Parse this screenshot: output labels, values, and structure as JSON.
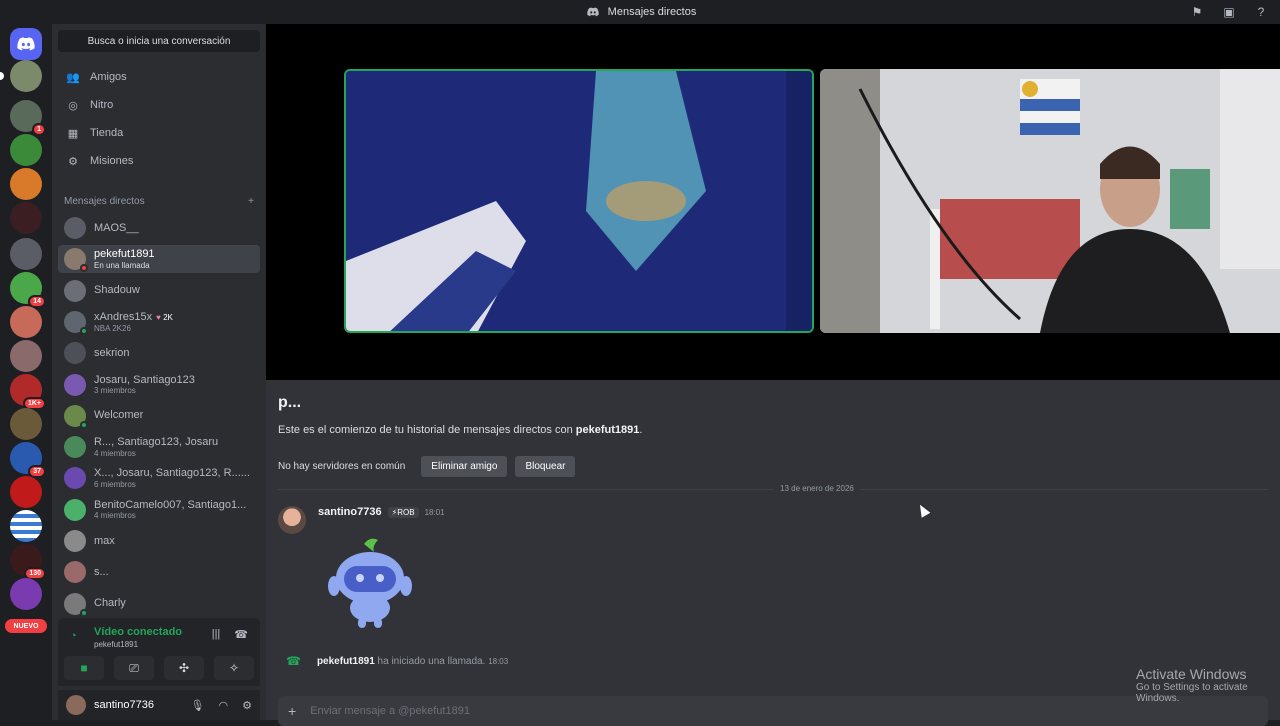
{
  "titlebar": {
    "title": "Mensajes directos"
  },
  "rail": {
    "servers": [
      {
        "id": "home",
        "badge": ""
      },
      {
        "id": "s1",
        "badge": ""
      },
      {
        "id": "s2",
        "badge": "1"
      },
      {
        "id": "s3",
        "badge": ""
      },
      {
        "id": "s4",
        "badge": ""
      },
      {
        "id": "s5",
        "badge": ""
      },
      {
        "id": "s6",
        "badge": ""
      },
      {
        "id": "s7",
        "badge": "14"
      },
      {
        "id": "s8",
        "badge": ""
      },
      {
        "id": "s9",
        "badge": ""
      },
      {
        "id": "s10",
        "badge": "1K+"
      },
      {
        "id": "s11",
        "badge": ""
      },
      {
        "id": "s12",
        "badge": "37"
      },
      {
        "id": "s13",
        "badge": ""
      },
      {
        "id": "s14",
        "badge": ""
      },
      {
        "id": "s15",
        "badge": "130"
      },
      {
        "id": "s16",
        "badge": ""
      }
    ],
    "nuevo_label": "NUEVO"
  },
  "sidebar": {
    "search_label": "Busca o inicia una conversación",
    "nav": [
      {
        "label": "Amigos",
        "icon": "friends-icon"
      },
      {
        "label": "Nitro",
        "icon": "nitro-icon"
      },
      {
        "label": "Tienda",
        "icon": "shop-icon"
      },
      {
        "label": "Misiones",
        "icon": "quests-icon"
      }
    ],
    "dm_header": "Mensajes directos",
    "dms": [
      {
        "name": "MAOS__",
        "sub": "",
        "color": "#5a5d66",
        "status": ""
      },
      {
        "name": "pekefut1891",
        "sub": "En una llamada",
        "color": "#8a7a6e",
        "status": "#f23f43"
      },
      {
        "name": "Shadouw",
        "sub": "",
        "color": "#6b6e77",
        "status": ""
      },
      {
        "name": "xAndres15x",
        "sub": "NBA 2K26",
        "color": "#5f6670",
        "status": "#23a55a",
        "badge": "2K"
      },
      {
        "name": "sekrion",
        "sub": "",
        "color": "#4d5058",
        "status": ""
      },
      {
        "name": "Josaru, Santiago123",
        "sub": "3 miembros",
        "color": "#7a5ab0",
        "status": ""
      },
      {
        "name": "Welcomer",
        "sub": "",
        "color": "#6b8a4a",
        "status": "#23a55a"
      },
      {
        "name": "R..., Santiago123, Josaru",
        "sub": "4 miembros",
        "color": "#4a8a5a",
        "status": ""
      },
      {
        "name": "X..., Josaru, Santiago123, R......",
        "sub": "6 miembros",
        "color": "#6a4ab0",
        "status": ""
      },
      {
        "name": "BenitoCamelo007, Santiago1...",
        "sub": "4 miembros",
        "color": "#4ab06a",
        "status": ""
      },
      {
        "name": "max",
        "sub": "",
        "color": "#8a8a8a",
        "status": ""
      },
      {
        "name": "s...",
        "sub": "",
        "color": "#9a6a6a",
        "status": ""
      },
      {
        "name": "Charly",
        "sub": "",
        "color": "#7a7a7a",
        "status": "#23a55a"
      }
    ],
    "voice": {
      "title": "Vídeo conectado",
      "channel": "pekefut1891"
    },
    "user": {
      "name": "santino7736"
    }
  },
  "main": {
    "intro_title": "p...",
    "intro_text_prefix": "Este es el comienzo de tu historial de mensajes directos con ",
    "intro_text_name": "pekefut1891",
    "intro_text_suffix": ".",
    "no_servers": "No hay servidores en común",
    "remove_friend": "Eliminar amigo",
    "block": "Bloquear",
    "date_divider": "13 de enero de 2026",
    "message": {
      "author": "santino7736",
      "tag": "ROB",
      "time": "18:01"
    },
    "system": {
      "author": "pekefut1891",
      "text": "ha iniciado una llamada.",
      "time": "18:03"
    },
    "composer_placeholder": "Enviar mensaje a @pekefut1891"
  },
  "watermark": {
    "line1": "Activate Windows",
    "line2": "Go to Settings to activate Windows."
  }
}
